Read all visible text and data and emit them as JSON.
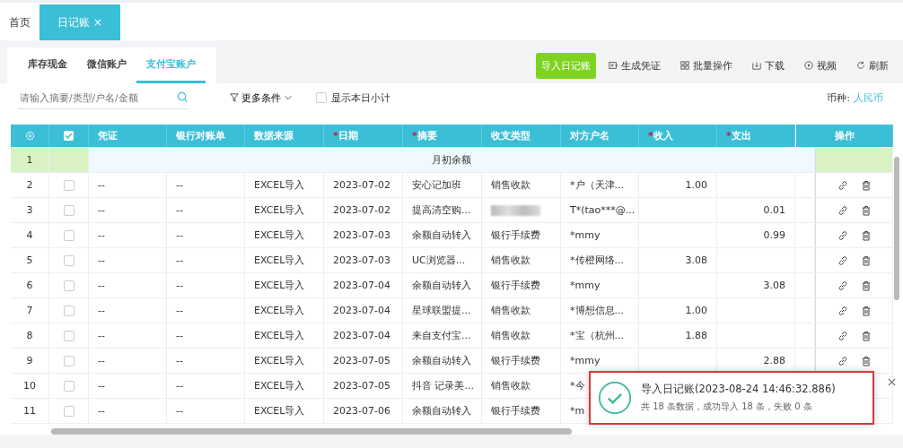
{
  "page_tabs": [
    {
      "label": "首页",
      "selected": false
    },
    {
      "label": "日记账",
      "selected": true,
      "close": "×"
    }
  ],
  "account_tabs": [
    {
      "label": "库存现金",
      "selected": false
    },
    {
      "label": "微信账户",
      "selected": false
    },
    {
      "label": "支付宝账户",
      "selected": true
    }
  ],
  "toolbar": [
    {
      "label": "导入日记账",
      "kind": "primary"
    },
    {
      "label": "生成凭证",
      "kind": "voucher"
    },
    {
      "label": "批量操作",
      "kind": "batch"
    },
    {
      "label": "下载",
      "kind": "download"
    },
    {
      "label": "视频",
      "kind": "video"
    },
    {
      "label": "刷新",
      "kind": "refresh"
    }
  ],
  "search": {
    "placeholder": "请输入摘要/类型/户名/金额"
  },
  "more_filters": "更多条件",
  "daily_subtotal": {
    "label": "显示本日小计",
    "checked": false
  },
  "currency": {
    "label": "币种:",
    "value": "人民币"
  },
  "table": {
    "select_all_checked": true,
    "columns": [
      {
        "label": "凭证"
      },
      {
        "label": "银行对账单"
      },
      {
        "label": "数据来源"
      },
      {
        "label": "日期",
        "required_mark": "*"
      },
      {
        "label": "摘要",
        "required_mark": "*"
      },
      {
        "label": "收支类型"
      },
      {
        "label": "对方户名"
      },
      {
        "label": "收入",
        "required_mark": "*"
      },
      {
        "label": "支出",
        "required_mark": "*"
      },
      {
        "label": "操作"
      }
    ],
    "rows": [
      {
        "kind": "opening",
        "no": "1",
        "summary": "月初余额"
      },
      {
        "kind": "entry",
        "no": "2",
        "checked": false,
        "voucher": "--",
        "statement": "--",
        "source": "EXCEL导入",
        "date": "2023-07-02",
        "summary": "安心记加班",
        "type": "销售收款",
        "type_hidden": false,
        "party": "*户（天津...",
        "income": "1.00"
      },
      {
        "kind": "entry",
        "no": "3",
        "checked": false,
        "voucher": "--",
        "statement": "--",
        "source": "EXCEL导入",
        "date": "2023-07-02",
        "summary": "提高清空购...",
        "type_hidden": true,
        "party": "T*(tao***@...",
        "expense": "0.01"
      },
      {
        "kind": "entry",
        "no": "4",
        "checked": false,
        "voucher": "--",
        "statement": "--",
        "source": "EXCEL导入",
        "date": "2023-07-03",
        "summary": "余额自动转入",
        "type": "银行手续费",
        "type_hidden": false,
        "party": "*mmy",
        "expense": "0.99"
      },
      {
        "kind": "entry",
        "no": "5",
        "checked": false,
        "voucher": "--",
        "statement": "--",
        "source": "EXCEL导入",
        "date": "2023-07-03",
        "summary": "UC浏览器...",
        "type": "销售收款",
        "type_hidden": false,
        "party": "*传橙网络...",
        "income": "3.08"
      },
      {
        "kind": "entry",
        "no": "6",
        "checked": false,
        "voucher": "--",
        "statement": "--",
        "source": "EXCEL导入",
        "date": "2023-07-04",
        "summary": "余额自动转入",
        "type": "银行手续费",
        "type_hidden": false,
        "party": "*mmy",
        "expense": "3.08"
      },
      {
        "kind": "entry",
        "no": "7",
        "checked": false,
        "voucher": "--",
        "statement": "--",
        "source": "EXCEL导入",
        "date": "2023-07-04",
        "summary": "星球联盟提...",
        "type": "销售收款",
        "type_hidden": false,
        "party": "*博想信息...",
        "income": "1.00"
      },
      {
        "kind": "entry",
        "no": "8",
        "checked": false,
        "voucher": "--",
        "statement": "--",
        "source": "EXCEL导入",
        "date": "2023-07-04",
        "summary": "来自支付宝...",
        "type": "销售收款",
        "type_hidden": false,
        "party": "*宝（杭州...",
        "income": "1.88"
      },
      {
        "kind": "entry",
        "no": "9",
        "checked": false,
        "voucher": "--",
        "statement": "--",
        "source": "EXCEL导入",
        "date": "2023-07-05",
        "summary": "余额自动转入",
        "type": "银行手续费",
        "type_hidden": false,
        "party": "*mmy",
        "expense": "2.88"
      },
      {
        "kind": "entry",
        "no": "10",
        "checked": false,
        "voucher": "--",
        "statement": "--",
        "source": "EXCEL导入",
        "date": "2023-07-05",
        "summary": "抖音 记录美...",
        "type": "销售收款",
        "type_hidden": false,
        "party": "*今"
      },
      {
        "kind": "entry",
        "no": "11",
        "checked": false,
        "voucher": "--",
        "statement": "--",
        "source": "EXCEL导入",
        "date": "2023-07-06",
        "summary": "余额自动转入",
        "type": "银行手续费",
        "type_hidden": false,
        "party": "*m"
      }
    ]
  },
  "notification": {
    "title": "导入日记账(2023-08-24 14:46:32.886)",
    "message": "共 18 条数据，成功导入 18 条，失败 0 条"
  }
}
